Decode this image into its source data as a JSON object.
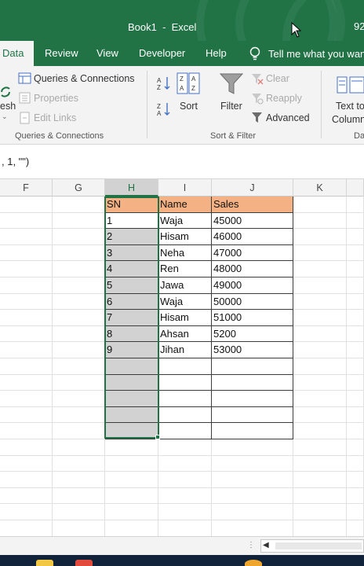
{
  "window": {
    "title": "Book1  -  Excel",
    "zoom_fragment": "92"
  },
  "tabs": [
    "Data",
    "Review",
    "View",
    "Developer",
    "Help"
  ],
  "tell_me": "Tell me what you want to do",
  "ribbon": {
    "refresh_fragment": "esh",
    "queries_connections": "Queries & Connections",
    "properties": "Properties",
    "edit_links": "Edit Links",
    "group_queries": "Queries & Connections",
    "sort": "Sort",
    "filter": "Filter",
    "clear": "Clear",
    "reapply": "Reapply",
    "advanced": "Advanced",
    "group_sort_filter": "Sort & Filter",
    "text_to_columns_1": "Text to",
    "text_to_columns_2": "Columns",
    "group_data_tools_fragment": "Da"
  },
  "formula": ", 1, \"\")",
  "columns": [
    "F",
    "G",
    "H",
    "I",
    "J",
    "K"
  ],
  "table": {
    "headers": [
      "SN",
      "Name",
      "Sales"
    ],
    "rows": [
      [
        "1",
        "Waja",
        "45000"
      ],
      [
        "2",
        "Hisam",
        "46000"
      ],
      [
        "3",
        "Neha",
        "47000"
      ],
      [
        "4",
        "Ren",
        "48000"
      ],
      [
        "5",
        "Jawa",
        "49000"
      ],
      [
        "6",
        "Waja",
        "50000"
      ],
      [
        "7",
        "Hisam",
        "51000"
      ],
      [
        "8",
        "Ahsan",
        "5200"
      ],
      [
        "9",
        "Jihan",
        "53000"
      ],
      [
        "",
        "",
        ""
      ],
      [
        "",
        "",
        ""
      ],
      [
        "",
        "",
        ""
      ],
      [
        "",
        "",
        ""
      ],
      [
        "",
        "",
        ""
      ]
    ]
  },
  "colors": {
    "excel_green": "#217346",
    "header_fill": "#f4b183",
    "selection_fill": "#d2d2d2"
  }
}
